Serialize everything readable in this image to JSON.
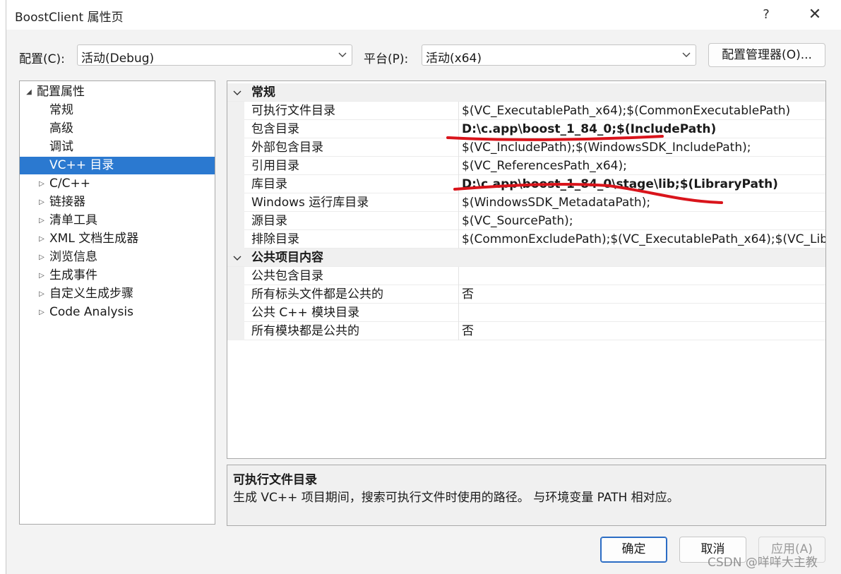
{
  "window": {
    "title": "BoostClient 属性页",
    "help": "?",
    "close": "✕"
  },
  "config": {
    "label": "配置(C):",
    "value": "活动(Debug)"
  },
  "platform": {
    "label": "平台(P):",
    "value": "活动(x64)"
  },
  "config_manager_label": "配置管理器(O)...",
  "tree": {
    "root": "配置属性",
    "items": [
      {
        "label": "常规",
        "expander": false,
        "selected": false
      },
      {
        "label": "高级",
        "expander": false,
        "selected": false
      },
      {
        "label": "调试",
        "expander": false,
        "selected": false
      },
      {
        "label": "VC++ 目录",
        "expander": false,
        "selected": true
      },
      {
        "label": "C/C++",
        "expander": true,
        "selected": false
      },
      {
        "label": "链接器",
        "expander": true,
        "selected": false
      },
      {
        "label": "清单工具",
        "expander": true,
        "selected": false
      },
      {
        "label": "XML 文档生成器",
        "expander": true,
        "selected": false
      },
      {
        "label": "浏览信息",
        "expander": true,
        "selected": false
      },
      {
        "label": "生成事件",
        "expander": true,
        "selected": false
      },
      {
        "label": "自定义生成步骤",
        "expander": true,
        "selected": false
      },
      {
        "label": "Code Analysis",
        "expander": true,
        "selected": false
      }
    ]
  },
  "grid": {
    "sections": [
      {
        "title": "常规",
        "rows": [
          {
            "name": "可执行文件目录",
            "value": "$(VC_ExecutablePath_x64);$(CommonExecutablePath)",
            "bold": false
          },
          {
            "name": "包含目录",
            "value": "D:\\c.app\\boost_1_84_0;$(IncludePath)",
            "bold": true
          },
          {
            "name": "外部包含目录",
            "value": "$(VC_IncludePath);$(WindowsSDK_IncludePath);",
            "bold": false
          },
          {
            "name": "引用目录",
            "value": "$(VC_ReferencesPath_x64);",
            "bold": false
          },
          {
            "name": "库目录",
            "value": "D:\\c.app\\boost_1_84_0\\stage\\lib;$(LibraryPath)",
            "bold": true
          },
          {
            "name": "Windows 运行库目录",
            "value": "$(WindowsSDK_MetadataPath);",
            "bold": false
          },
          {
            "name": "源目录",
            "value": "$(VC_SourcePath);",
            "bold": false
          },
          {
            "name": "排除目录",
            "value": "$(CommonExcludePath);$(VC_ExecutablePath_x64);$(VC_Lib",
            "bold": false
          }
        ]
      },
      {
        "title": "公共项目内容",
        "rows": [
          {
            "name": "公共包含目录",
            "value": "",
            "bold": false
          },
          {
            "name": "所有标头文件都是公共的",
            "value": "否",
            "bold": false
          },
          {
            "name": "公共 C++ 模块目录",
            "value": "",
            "bold": false
          },
          {
            "name": "所有模块都是公共的",
            "value": "否",
            "bold": false
          }
        ]
      }
    ]
  },
  "description": {
    "title": "可执行文件目录",
    "text": "生成 VC++ 项目期间，搜索可执行文件时使用的路径。 与环境变量 PATH 相对应。"
  },
  "buttons": {
    "ok": "确定",
    "cancel": "取消",
    "apply": "应用(A)"
  },
  "watermark": "CSDN @咩咩大主教",
  "colors": {
    "selection": "#2b79d0",
    "annotation": "#d9141b",
    "ok_border": "#2b6cc4"
  }
}
